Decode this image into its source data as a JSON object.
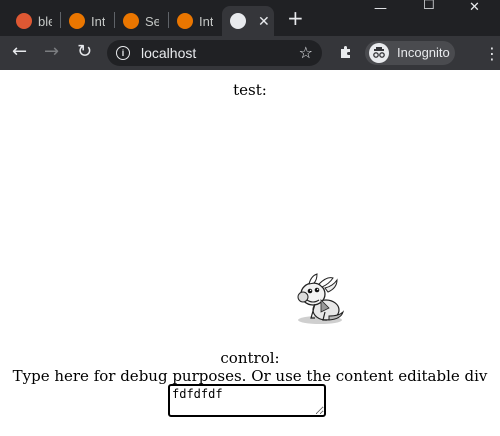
{
  "browser": {
    "tabs": [
      {
        "title": "ble",
        "icon": "duckduckgo-icon",
        "color": "#de5833"
      },
      {
        "title": "Int",
        "icon": "blender-icon",
        "color": "#ea7600"
      },
      {
        "title": "Se",
        "icon": "blender-icon",
        "color": "#ea7600"
      },
      {
        "title": "Int",
        "icon": "blender-icon",
        "color": "#ea7600"
      }
    ],
    "active_tab": {
      "icon": "globe-icon",
      "close": "✕"
    },
    "new_tab": "+",
    "window": {
      "minimize": "—",
      "maximize": "☐",
      "close": "✕"
    },
    "nav": {
      "back": "←",
      "forward": "→",
      "reload": "↻"
    },
    "address": {
      "url": "localhost",
      "info": "i",
      "star": "☆"
    },
    "extensions_icon": "puzzle-icon",
    "profile": {
      "label": "Incognito"
    },
    "menu": "⋮"
  },
  "page": {
    "test_label": "test:",
    "control_label": "control:",
    "debug_text": "Type here for debug purposes. Or use the content editable div above",
    "debug_input_value": "fdfdfdf"
  }
}
